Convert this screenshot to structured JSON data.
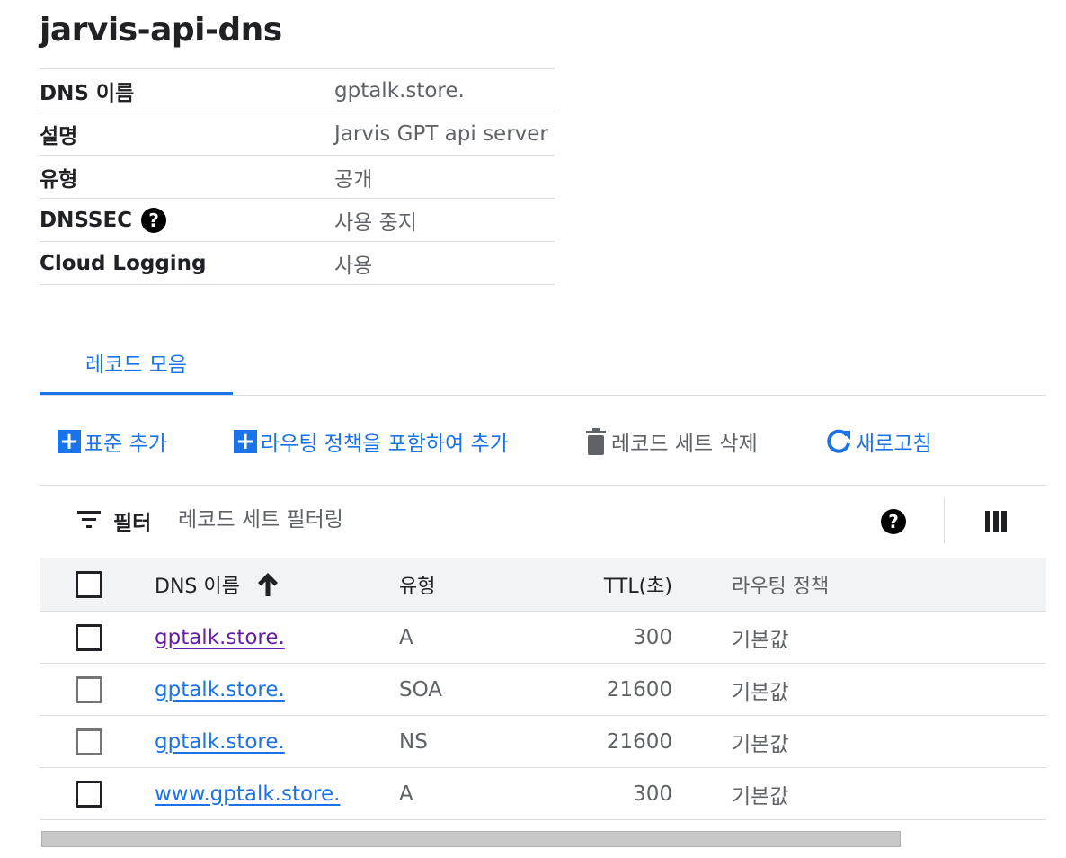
{
  "page": {
    "title": "jarvis-api-dns"
  },
  "details": [
    {
      "label": "DNS 이름",
      "value": "gptalk.store.",
      "help": false
    },
    {
      "label": "설명",
      "value": "Jarvis GPT api server",
      "help": false
    },
    {
      "label": "유형",
      "value": "공개",
      "help": false
    },
    {
      "label": "DNSSEC",
      "value": "사용 중지",
      "help": true
    },
    {
      "label": "Cloud Logging",
      "value": "사용",
      "help": false
    }
  ],
  "tabs": [
    {
      "label": "레코드 모음",
      "active": true
    }
  ],
  "toolbar": {
    "add_standard": "표준 추가",
    "add_with_routing": "라우팅 정책을 포함하여 추가",
    "delete_record_set": "레코드 세트 삭제",
    "refresh": "새로고침"
  },
  "filter": {
    "label": "필터",
    "placeholder": "레코드 세트 필터링"
  },
  "table": {
    "columns": {
      "dns_name": "DNS 이름",
      "type": "유형",
      "ttl": "TTL(초)",
      "routing_policy": "라우팅 정책"
    },
    "rows": [
      {
        "dns_name": "gptalk.store.",
        "type": "A",
        "ttl": "300",
        "routing_policy": "기본값",
        "visited": true,
        "checkbox_disabled": false
      },
      {
        "dns_name": "gptalk.store.",
        "type": "SOA",
        "ttl": "21600",
        "routing_policy": "기본값",
        "visited": false,
        "checkbox_disabled": true
      },
      {
        "dns_name": "gptalk.store.",
        "type": "NS",
        "ttl": "21600",
        "routing_policy": "기본값",
        "visited": false,
        "checkbox_disabled": true
      },
      {
        "dns_name": "www.gptalk.store.",
        "type": "A",
        "ttl": "300",
        "routing_policy": "기본값",
        "visited": false,
        "checkbox_disabled": false
      }
    ]
  },
  "colors": {
    "accent": "#1a73e8",
    "visited_link": "#681da8",
    "border": "#dadce0",
    "header_bg": "#f1f3f4",
    "muted_text": "#5f6368"
  },
  "icons": {
    "help": "question-circle-icon",
    "add": "plus-box-icon",
    "delete": "trash-icon",
    "refresh": "refresh-icon",
    "filter": "filter-lines-icon",
    "columns": "column-display-icon",
    "sort": "arrow-up-icon"
  }
}
